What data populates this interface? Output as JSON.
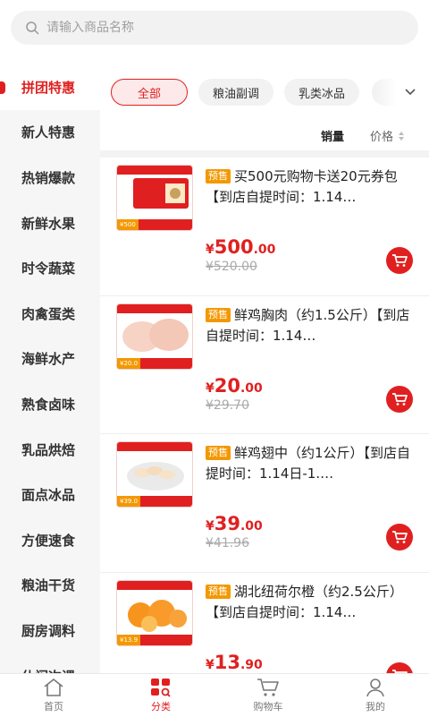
{
  "search": {
    "placeholder": "请输入商品名称"
  },
  "sidebar": {
    "items": [
      {
        "label": "拼团特惠"
      },
      {
        "label": "新人特惠"
      },
      {
        "label": "热销爆款"
      },
      {
        "label": "新鲜水果"
      },
      {
        "label": "时令蔬菜"
      },
      {
        "label": "肉禽蛋类"
      },
      {
        "label": "海鲜水产"
      },
      {
        "label": "熟食卤味"
      },
      {
        "label": "乳品烘焙"
      },
      {
        "label": "面点冰品"
      },
      {
        "label": "方便速食"
      },
      {
        "label": "粮油干货"
      },
      {
        "label": "厨房调料"
      },
      {
        "label": "休闲次课"
      }
    ]
  },
  "chips": [
    {
      "label": "全部"
    },
    {
      "label": "粮油副调"
    },
    {
      "label": "乳类冰品"
    }
  ],
  "sort": {
    "sales": "销量",
    "price": "价格"
  },
  "products": [
    {
      "badge": "预售",
      "title": "买500元购物卡送20元券包【到店自提时间：1.14…",
      "cur": "¥",
      "int": "500",
      "dec": ".00",
      "old": "¥520.00",
      "thumb_price": "¥500"
    },
    {
      "badge": "预售",
      "title": "鲜鸡胸肉（约1.5公斤）【到店自提时间：1.14…",
      "cur": "¥",
      "int": "20",
      "dec": ".00",
      "old": "¥29.70",
      "thumb_price": "¥20.0"
    },
    {
      "badge": "预售",
      "title": "鲜鸡翅中（约1公斤）【到店自提时间：1.14日-1.…",
      "cur": "¥",
      "int": "39",
      "dec": ".00",
      "old": "¥41.96",
      "thumb_price": "¥39.0"
    },
    {
      "badge": "预售",
      "title": "湖北纽荷尔橙（约2.5公斤）【到店自提时间：1.14…",
      "cur": "¥",
      "int": "13",
      "dec": ".90",
      "old": "",
      "thumb_price": "¥13.9"
    }
  ],
  "tabs": [
    {
      "label": "首页"
    },
    {
      "label": "分类"
    },
    {
      "label": "购物车"
    },
    {
      "label": "我的"
    }
  ],
  "colors": {
    "accent": "#e02020",
    "presale": "#f39800"
  }
}
